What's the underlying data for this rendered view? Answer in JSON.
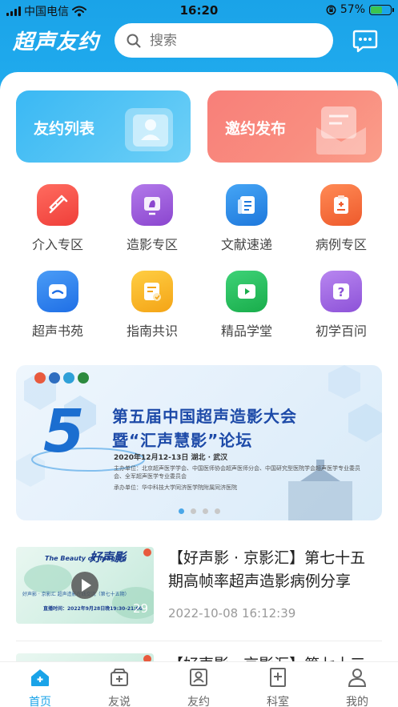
{
  "status_bar": {
    "carrier": "中国电信",
    "time": "16:20",
    "battery": "57%",
    "battery_level": 0.57
  },
  "header": {
    "logo": "超声友约",
    "search_placeholder": "搜索",
    "icon_message": "chat-bubble-icon"
  },
  "cards": [
    {
      "label": "友约列表",
      "color": "#4bbdf3"
    },
    {
      "label": "邀约发布",
      "color": "#f8867c"
    }
  ],
  "grid": [
    {
      "label": "介入专区",
      "color": "#f25248"
    },
    {
      "label": "造影专区",
      "color": "#9b5ad8"
    },
    {
      "label": "文献速递",
      "color": "#2c8ee8"
    },
    {
      "label": "病例专区",
      "color": "#f2673a"
    },
    {
      "label": "超声书苑",
      "color": "#2b82ec"
    },
    {
      "label": "指南共识",
      "color": "#f6b526"
    },
    {
      "label": "精品学堂",
      "color": "#26c25e"
    },
    {
      "label": "初学百问",
      "color": "#a56ae0"
    }
  ],
  "banner": {
    "number": "5",
    "title_line1": "第五届中国超声造影大会",
    "title_line2": "暨“汇声慧影”论坛",
    "date": "2020年12月12-13日   湖北 · 武汉",
    "host": "主办单位：北京超声医学学会、中国医师协会超声医师分会、中国研究型医院学会超声医学专业委员会、全军超声医学专业委员会",
    "undertaker": "承办单位：华中科技大学同济医学院附属同济医院",
    "current_slide": 1,
    "slide_count": 4
  },
  "news": [
    {
      "title": "【好声影 · 京影汇】第七十五期高帧率超声造影病例分享",
      "time": "2022-10-08 16:12:39",
      "thumb": {
        "heading": "The Beauty of Imaging",
        "brand": "好声影",
        "subtitle": "好声影 · 京影汇  超声造影在线交流（第七十五期）",
        "live_time": "直播时间：2022年9月28日晚19:30-21:00",
        "num": "29"
      }
    },
    {
      "title": "【好声影 · 京影汇】第七十三",
      "time": "",
      "thumb": {
        "heading": "",
        "brand": "",
        "subtitle": "",
        "live_time": "",
        "num": ""
      }
    }
  ],
  "tabbar": [
    {
      "label": "首页",
      "icon": "home-icon",
      "active": true
    },
    {
      "label": "友说",
      "icon": "box-plus-icon",
      "active": false
    },
    {
      "label": "友约",
      "icon": "contact-card-icon",
      "active": false
    },
    {
      "label": "科室",
      "icon": "hospital-icon",
      "active": false
    },
    {
      "label": "我的",
      "icon": "person-icon",
      "active": false
    }
  ],
  "colors": {
    "primary": "#1aa3e8",
    "active_tab": "#1aa3e8"
  }
}
